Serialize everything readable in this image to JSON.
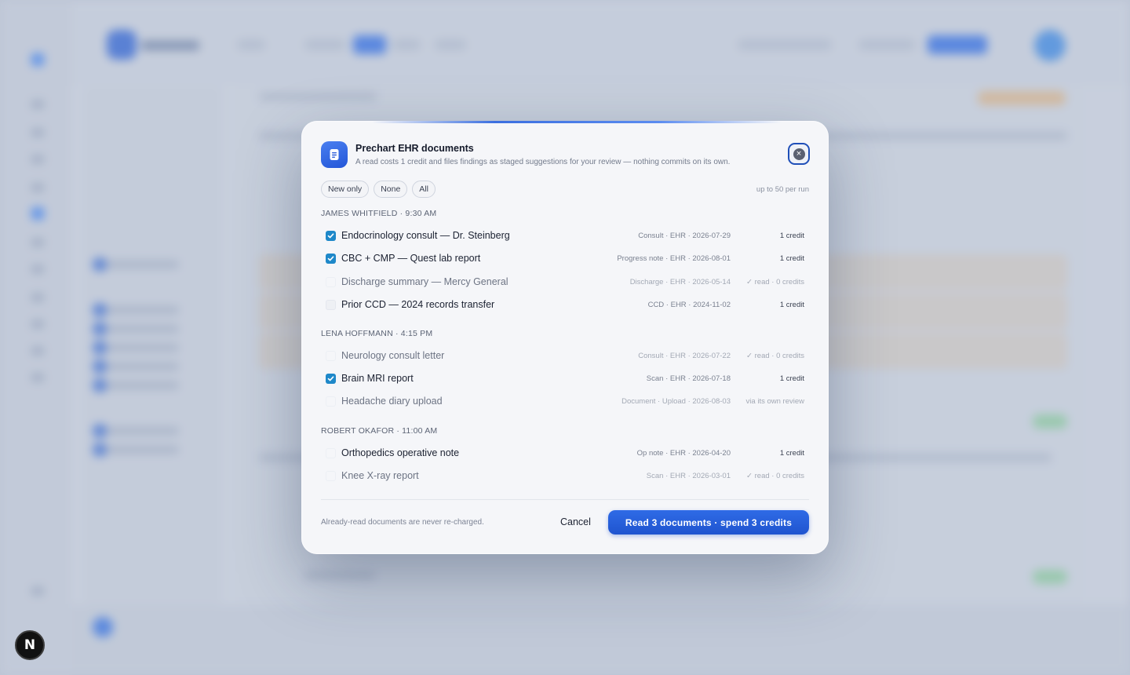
{
  "corner_badge": {
    "label": "N"
  },
  "modal": {
    "title": "Prechart EHR documents",
    "subtitle": "A read costs 1 credit and files findings as staged suggestions for your review — nothing commits on its own.",
    "icon": "document-icon",
    "close_icon": "close-icon",
    "filters": [
      "New only",
      "None",
      "All"
    ],
    "limit_note": "up to 50 per run",
    "groups": [
      {
        "label": "JAMES WHITFIELD · 9:30 AM",
        "docs": [
          {
            "title": "Endocrinology consult — Dr. Steinberg",
            "meta": "Consult · EHR · 2026-07-29",
            "cost": "1 credit",
            "checked": true,
            "state": "new"
          },
          {
            "title": "CBC + CMP — Quest lab report",
            "meta": "Progress note · EHR · 2026-08-01",
            "cost": "1 credit",
            "checked": true,
            "state": "new"
          },
          {
            "title": "Discharge summary — Mercy General",
            "meta": "Discharge · EHR · 2026-05-14",
            "cost": "✓ read · 0 credits",
            "checked": false,
            "state": "read"
          },
          {
            "title": "Prior CCD — 2024 records transfer",
            "meta": "CCD · EHR · 2024-11-02",
            "cost": "1 credit",
            "checked": false,
            "state": "new"
          }
        ]
      },
      {
        "label": "LENA HOFFMANN · 4:15 PM",
        "docs": [
          {
            "title": "Neurology consult letter",
            "meta": "Consult · EHR · 2026-07-22",
            "cost": "✓ read · 0 credits",
            "checked": false,
            "state": "read"
          },
          {
            "title": "Brain MRI report",
            "meta": "Scan · EHR · 2026-07-18",
            "cost": "1 credit",
            "checked": true,
            "state": "new"
          },
          {
            "title": "Headache diary upload",
            "meta": "Document · Upload · 2026-08-03",
            "cost": "via its own review",
            "checked": false,
            "state": "read"
          }
        ]
      },
      {
        "label": "ROBERT OKAFOR · 11:00 AM",
        "docs": [
          {
            "title": "Orthopedics operative note",
            "meta": "Op note · EHR · 2026-04-20",
            "cost": "1 credit",
            "checked": false,
            "state": "new"
          },
          {
            "title": "Knee X-ray report",
            "meta": "Scan · EHR · 2026-03-01",
            "cost": "✓ read · 0 credits",
            "checked": false,
            "state": "read"
          }
        ]
      }
    ],
    "footer_note": "Already-read documents are never re-charged.",
    "cancel_label": "Cancel",
    "primary_label": "Read 3 documents · spend 3 credits"
  },
  "colors": {
    "accent": "#2f6be6",
    "checkbox": "#1e88c9"
  }
}
